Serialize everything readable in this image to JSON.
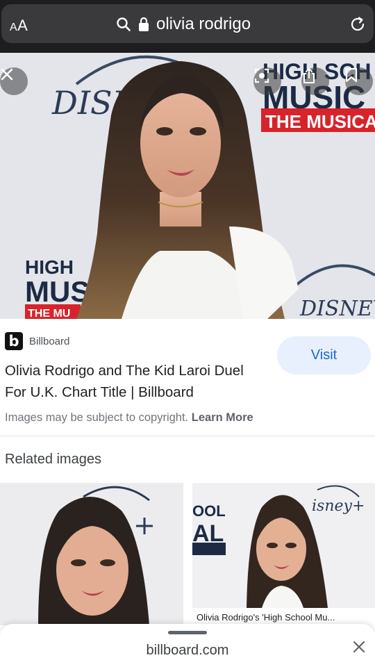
{
  "browser": {
    "aa_small": "A",
    "aa_large": "A",
    "query": "olivia rodrigo",
    "icons": [
      "text-size-icon",
      "search-icon",
      "lock-icon",
      "reload-icon"
    ]
  },
  "hero": {
    "brand_left": "DISNEP",
    "logo_right_line1": "HIGH SCH",
    "logo_right_line2": "MUSIC",
    "logo_right_line3": "THE MUSICAL",
    "logo_left_line1": "HIGH",
    "logo_left_line2": "MUS",
    "logo_left_line3": "THE MU",
    "brand_bottom": "DISNEY",
    "icons": [
      "close-icon",
      "lens-icon",
      "share-icon",
      "bookmark-icon"
    ]
  },
  "result": {
    "favicon_letter": "b",
    "source": "Billboard",
    "title": "Olivia Rodrigo and The Kid Laroi Duel For U.K. Chart Title | Billboard",
    "visit_label": "Visit",
    "copyright_text": "Images may be subject to copyright.",
    "learn_more": "Learn More"
  },
  "related": {
    "heading": "Related images",
    "items": [
      {
        "caption": ""
      },
      {
        "caption": "Olivia Rodrigo's 'High School Mu..."
      }
    ]
  },
  "sheet": {
    "domain": "billboard.com"
  },
  "colors": {
    "address_bar": "#3a3a3c",
    "visit_bg": "#e8f0fe",
    "visit_text": "#1967d2",
    "hsm_red": "#d8232a"
  }
}
